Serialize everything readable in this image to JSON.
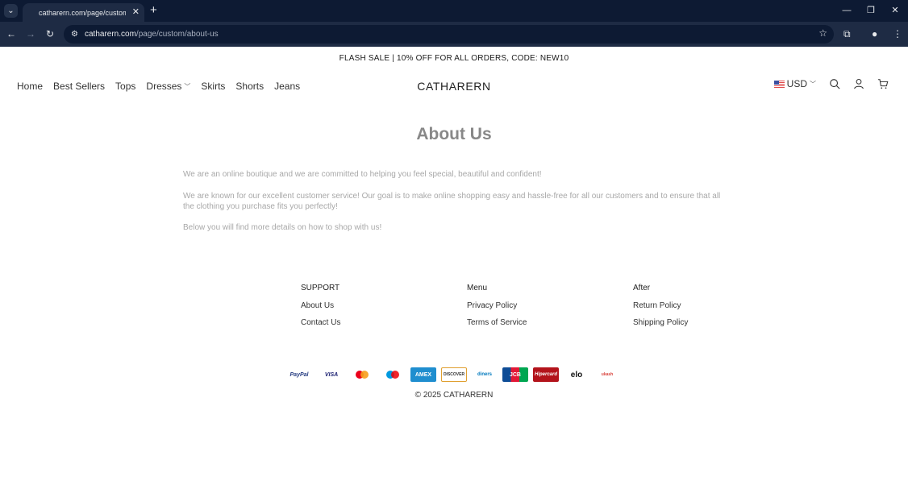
{
  "browser": {
    "tab_title": "catharern.com/page/custom/about-us",
    "url_domain": "catharern.com",
    "url_path": "/page/custom/about-us"
  },
  "announcement": "FLASH SALE | 10% OFF FOR ALL ORDERS, CODE: NEW10",
  "nav": {
    "items": [
      "Home",
      "Best Sellers",
      "Tops",
      "Dresses",
      "Skirts",
      "Shorts",
      "Jeans"
    ]
  },
  "brand": "CATHARERN",
  "currency": "USD",
  "page": {
    "title": "About Us",
    "paragraphs": [
      "We are an online boutique and we are committed to helping you feel special, beautiful and confident!",
      "We are known for our excellent customer service! Our goal is to make online shopping easy and hassle-free for all our customers and to ensure that all the clothing you purchase fits you perfectly!",
      "Below you will find more details on how to shop with us!"
    ]
  },
  "footer": {
    "columns": [
      {
        "heading": "SUPPORT",
        "links": [
          "About Us",
          "Contact Us"
        ]
      },
      {
        "heading": "Menu",
        "links": [
          "Privacy Policy",
          "Terms of Service"
        ]
      },
      {
        "heading": "After",
        "links": [
          "Return Policy",
          "Shipping Policy"
        ]
      }
    ],
    "payments": [
      "PayPal",
      "VISA",
      "mastercard",
      "maestro",
      "AMEX",
      "DISCOVER",
      "diners",
      "JCB",
      "Hipercard",
      "elo",
      "ukash"
    ],
    "copyright": "© 2025 CATHARERN"
  },
  "colors": {
    "chrome_dark": "#0d1a33",
    "chrome_mid": "#1e2b44",
    "title_gray": "#888888",
    "body_gray": "#a8a8a8"
  }
}
